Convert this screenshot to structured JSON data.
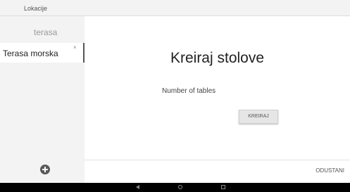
{
  "topbar": {
    "label": "Lokacije"
  },
  "sidebar": {
    "items": [
      {
        "label": "terasa"
      },
      {
        "label": "Terasa morska",
        "close_icon": "×"
      }
    ]
  },
  "dialog": {
    "title": "Kreiraj stolove",
    "field_label": "Number of tables",
    "create_button": "KREIRAJ",
    "cancel_button": "ODUSTANI"
  },
  "colors": {
    "sidebar_bg": "#f3f3f3",
    "nav_bg": "#000000",
    "active_indicator": "#555555"
  }
}
